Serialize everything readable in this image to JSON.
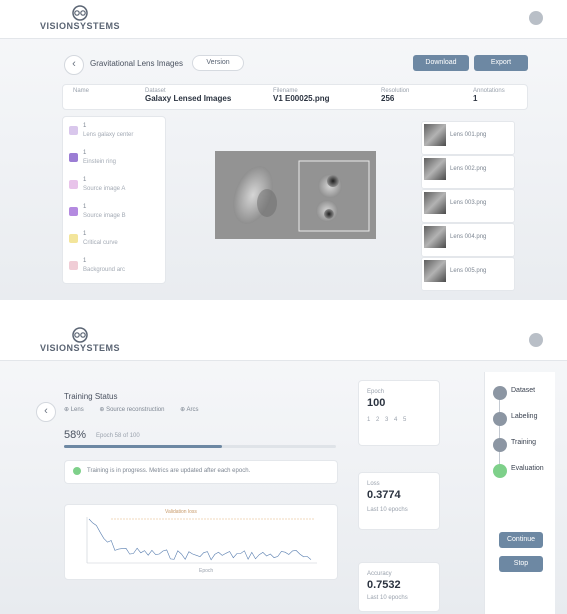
{
  "brand": {
    "name": "VISIONSYSTEMS"
  },
  "top": {
    "title": "Gravitational Lens Images",
    "dropdown": "Version",
    "button_a": "Download",
    "button_b": "Export",
    "meta": [
      {
        "label": "Name",
        "value": ""
      },
      {
        "label": "Dataset",
        "value": "Galaxy Lensed Images"
      },
      {
        "label": "Filename",
        "value": "V1 E00025.png"
      },
      {
        "label": "Resolution",
        "value": "256"
      },
      {
        "label": "Annotations",
        "value": "1"
      }
    ],
    "labels": [
      {
        "title": "1",
        "sub": "Lens galaxy center",
        "color": "#d9c7ec"
      },
      {
        "title": "1",
        "sub": "Einstein ring",
        "color": "#9b7dd4"
      },
      {
        "title": "1",
        "sub": "Source image A",
        "color": "#e8c3ea"
      },
      {
        "title": "1",
        "sub": "Source image B",
        "color": "#b48ae0"
      },
      {
        "title": "1",
        "sub": "Critical curve",
        "color": "#f3e59b"
      },
      {
        "title": "1",
        "sub": "Background arc",
        "color": "#f0cdd6"
      }
    ],
    "thumbs": [
      {
        "label": "Lens 001.png"
      },
      {
        "label": "Lens 002.png"
      },
      {
        "label": "Lens 003.png"
      },
      {
        "label": "Lens 004.png"
      },
      {
        "label": "Lens 005.png"
      }
    ]
  },
  "bottom": {
    "title": "Training Status",
    "tags": [
      "Lens",
      "Source reconstruction",
      "Arcs"
    ],
    "progress_text": "58%",
    "progress_sub": "Epoch 58 of 100",
    "progress": 0.58,
    "alert": "Training is in progress. Metrics are updated after each epoch.",
    "chart_title": "Validation loss",
    "chart_xlabel": "Epoch",
    "metrics": [
      {
        "label": "Epoch",
        "value": "100",
        "sub": "1 2 3 4 5"
      },
      {
        "label": "Loss",
        "value": "0.3774",
        "sub": "Last 10 epochs"
      },
      {
        "label": "Accuracy",
        "value": "0.7532",
        "sub": "Last 10 epochs"
      }
    ],
    "stages": [
      "Dataset",
      "Labeling",
      "Training",
      "Evaluation"
    ],
    "actions": [
      "Continue",
      "Stop"
    ]
  },
  "colors": {
    "accent": "#6d88a3",
    "done": "#8c96a3",
    "active": "#7ed08a"
  }
}
